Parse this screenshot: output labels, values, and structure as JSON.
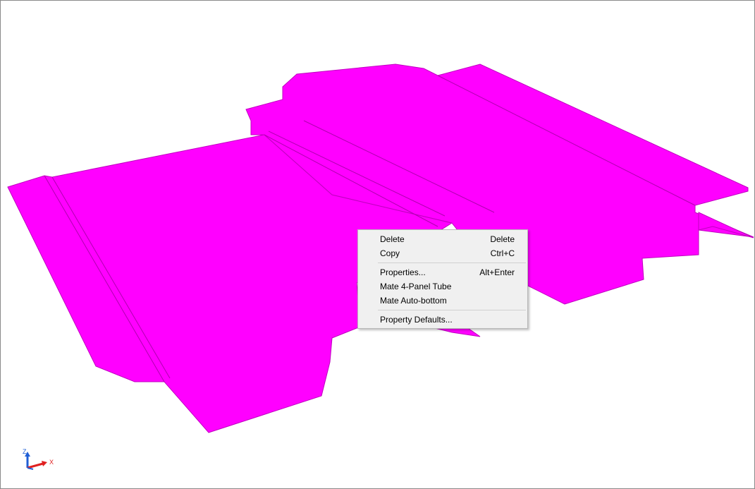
{
  "viewport": {
    "model_color": "#ff00ff",
    "edge_color": "#b300b3"
  },
  "context_menu": {
    "items": [
      {
        "label": "Delete",
        "shortcut": "Delete"
      },
      {
        "label": "Copy",
        "shortcut": "Ctrl+C"
      },
      {
        "label": "Properties...",
        "shortcut": "Alt+Enter"
      },
      {
        "label": "Mate 4-Panel Tube",
        "shortcut": ""
      },
      {
        "label": "Mate Auto-bottom",
        "shortcut": ""
      },
      {
        "label": "Property Defaults...",
        "shortcut": ""
      }
    ]
  },
  "axis_triad": {
    "z_label": "Z",
    "x_label": "X",
    "z_color": "#1f5fd6",
    "x_color": "#e02020"
  }
}
